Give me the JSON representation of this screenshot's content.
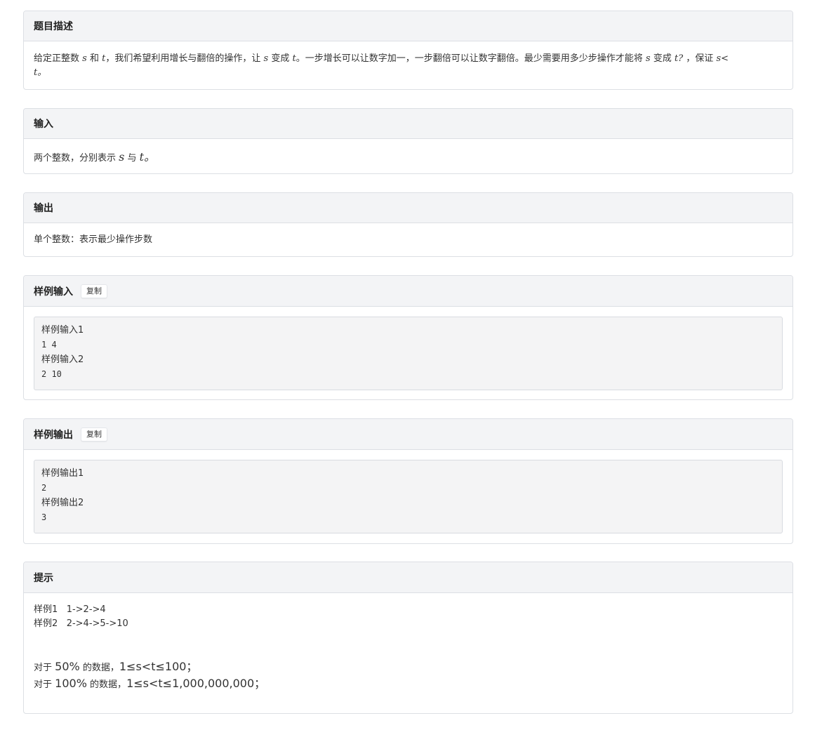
{
  "description": {
    "title": "题目描述",
    "line1": "给定正整数",
    "s": "s",
    "he": "和",
    "t": "t",
    "mid1": "，我们希望利用增长与翻倍的操作，让",
    "s2": "s",
    "bian": "变成",
    "t2": "t",
    "mid2": "。一步增长可以让数字加一，一步翻倍可以让数字翻倍。最少需要用多少步操作才能将",
    "s3": "s",
    "bian2": "变成",
    "t3": "t?",
    "guarantee": "，保证",
    "cond": "s<",
    "line2": "t。"
  },
  "input": {
    "title": "输入",
    "text_a": "两个整数，分别表示",
    "s": "s",
    "yu": "与",
    "t": "t。"
  },
  "output": {
    "title": "输出",
    "text": "单个整数：表示最少操作步数"
  },
  "sample_input": {
    "title": "样例输入",
    "copy_label": "复制",
    "lines": [
      "样例输入1",
      "1 4",
      "样例输入2",
      "2 10"
    ]
  },
  "sample_output": {
    "title": "样例输出",
    "copy_label": "复制",
    "lines": [
      "样例输出1",
      "2",
      "样例输出2",
      "3"
    ]
  },
  "hint": {
    "title": "提示",
    "ex1_label": "样例1",
    "ex1_path": "1->2->4",
    "ex2_label": "样例2",
    "ex2_path": "2->4->5->10",
    "range1_prefix": "对于",
    "range1_pct": "50%",
    "range1_mid": "的数据，",
    "range1_expr": "1≤s<t≤100；",
    "range2_prefix": "对于",
    "range2_pct": "100%",
    "range2_mid": "的数据，",
    "range2_expr": "1≤s<t≤1,000,000,000；"
  }
}
